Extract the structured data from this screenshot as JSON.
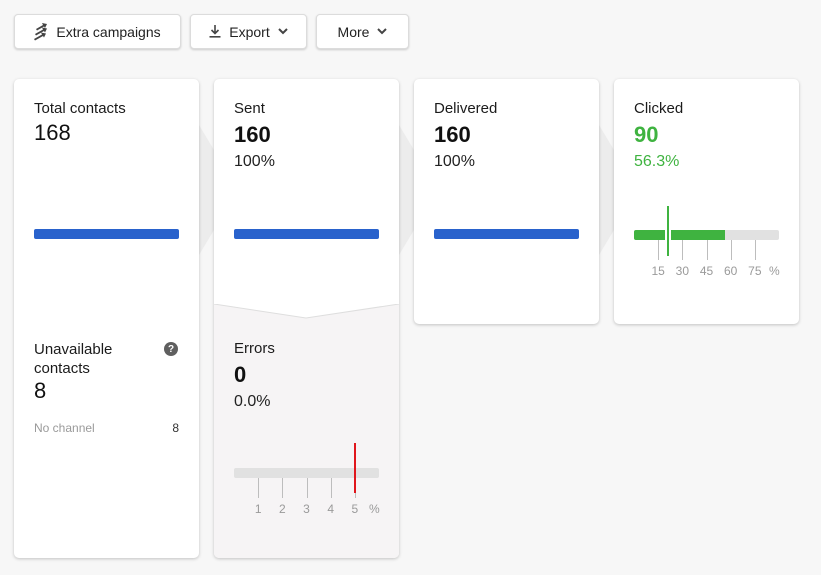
{
  "toolbar": {
    "extra_campaigns": {
      "label": "Extra campaigns",
      "icon": "shuffle-arrows-icon"
    },
    "export": {
      "label": "Export",
      "icon": "download-icon"
    },
    "more": {
      "label": "More"
    }
  },
  "colors": {
    "bar_blue": "#2962cc",
    "success_green": "#3fb340",
    "error_red": "#e0161c",
    "track_gray": "#e1e1e1"
  },
  "total_contacts": {
    "label": "Total contacts",
    "value": "168",
    "bar_fraction": 1.0
  },
  "unavailable": {
    "label": "Unavailable contacts",
    "value": "8",
    "help_icon": "question-circle-icon",
    "breakdown": [
      {
        "label": "No channel",
        "value": "8"
      }
    ]
  },
  "sent": {
    "label": "Sent",
    "value": "160",
    "percent": "100%",
    "bar_fraction": 1.0
  },
  "errors": {
    "label": "Errors",
    "value": "0",
    "percent": "0.0%",
    "gauge": {
      "value_percent": 0.0,
      "max_percent": 6,
      "threshold_percent": 5,
      "ticks": [
        "1",
        "2",
        "3",
        "4",
        "5"
      ],
      "unit": "%"
    }
  },
  "delivered": {
    "label": "Delivered",
    "value": "160",
    "percent": "100%",
    "bar_fraction": 1.0
  },
  "clicked": {
    "label": "Clicked",
    "value": "90",
    "percent": "56.3%",
    "gauge": {
      "value_percent": 56.3,
      "max_percent": 90,
      "benchmark_percent": 21,
      "ticks": [
        "15",
        "30",
        "45",
        "60",
        "75"
      ],
      "unit": "%"
    }
  }
}
